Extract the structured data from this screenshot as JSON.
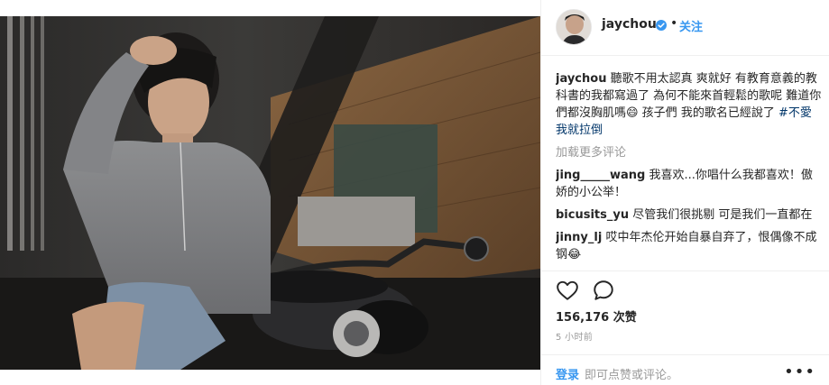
{
  "post": {
    "author": "jaychou",
    "follow_label": "关注",
    "header_separator": "•"
  },
  "caption": {
    "username": "jaychou",
    "text": "聽歌不用太認真 爽就好 有教育意義的教科書的我都寫過了 為何不能來首輕鬆的歌呢 難道你們都沒胸肌嗎😄 孩子們 我的歌名已經說了",
    "hashtag": "#不愛我就拉倒"
  },
  "load_more_label": "加载更多评论",
  "comments": [
    {
      "username": "jing_____wang",
      "text": "我喜欢...你唱什么我都喜欢！傲娇的小公举！"
    },
    {
      "username": "bicusits_yu",
      "text": "尽管我们很挑剔 可是我们一直都在"
    },
    {
      "username": "jinny_lj",
      "text": "哎中年杰伦开始自暴自弃了，恨偶像不成钢😂"
    }
  ],
  "stats": {
    "likes": "156,176 次赞",
    "time": "5 小时前"
  },
  "footer": {
    "login_label": "登录",
    "login_rest": "即可点赞或评论。",
    "more_label": "•••"
  },
  "icons": {
    "heart": "heart-icon",
    "comment": "comment-icon",
    "verified": "verified-badge-icon",
    "more": "more-options-icon"
  },
  "colors": {
    "link_blue": "#3897f0",
    "hashtag": "#003569",
    "muted": "#999999",
    "text": "#262626"
  }
}
